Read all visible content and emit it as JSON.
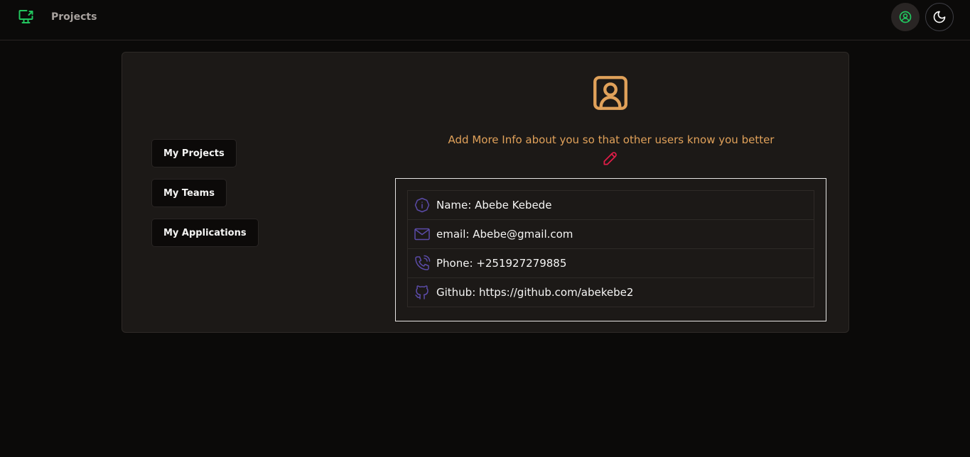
{
  "header": {
    "nav_projects": "Projects",
    "logo_icon": "monitor-share-icon",
    "profile_icon": "user-circle-icon",
    "theme_icon": "moon-icon"
  },
  "sidebar": {
    "buttons": [
      {
        "label": "My Projects"
      },
      {
        "label": "My Teams"
      },
      {
        "label": "My Applications"
      }
    ]
  },
  "profile": {
    "avatar_icon": "user-square-icon",
    "prompt": "Add More Info about you so that other users know you better",
    "edit_icon": "pencil-icon",
    "details": [
      {
        "icon": "info-octagon-icon",
        "text": "Name: Abebe Kebede"
      },
      {
        "icon": "mail-icon",
        "text": "email: Abebe@gmail.com"
      },
      {
        "icon": "phone-icon",
        "text": "Phone: +251927279885"
      },
      {
        "icon": "github-icon",
        "text": "Github: https://github.com/abekebe2"
      }
    ]
  },
  "colors": {
    "background": "#0b0a09",
    "card": "#1c1917",
    "accent_green": "#22c55e",
    "accent_orange": "#e0a15a",
    "pencil_red": "#e11d48",
    "icon_purple": "#5b4ba8"
  }
}
